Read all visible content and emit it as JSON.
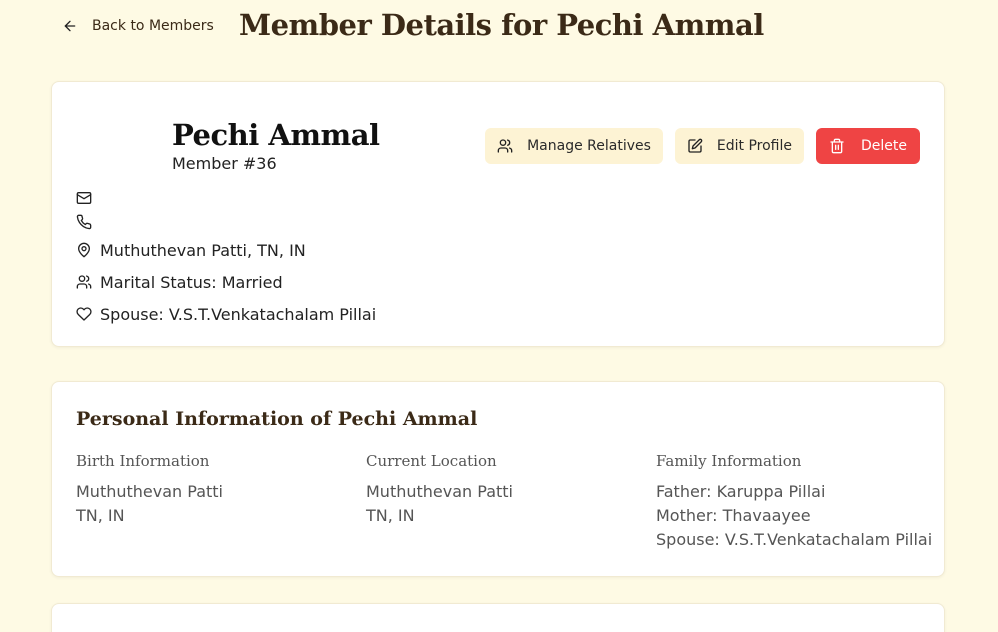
{
  "header": {
    "back_label": "Back to Members",
    "title": "Member Details for Pechi Ammal"
  },
  "profile": {
    "name": "Pechi Ammal",
    "member_number": "Member #36",
    "location": "Muthuthevan Patti, TN, IN",
    "marital_status": "Marital Status: Married",
    "spouse": "Spouse: V.S.T.Venkatachalam Pillai"
  },
  "actions": {
    "manage_relatives": "Manage Relatives",
    "edit_profile": "Edit Profile",
    "delete": "Delete"
  },
  "personal_info": {
    "title": "Personal Information of Pechi Ammal",
    "birth": {
      "heading": "Birth Information",
      "line1": "Muthuthevan Patti",
      "line2": "TN, IN"
    },
    "current": {
      "heading": "Current Location",
      "line1": "Muthuthevan Patti",
      "line2": "TN, IN"
    },
    "family": {
      "heading": "Family Information",
      "father": "Father: Karuppa Pillai",
      "mother": "Mother: Thavaayee",
      "spouse": "Spouse: V.S.T.Venkatachalam Pillai"
    }
  },
  "colors": {
    "background": "#fefae4",
    "accent": "#3b2a17",
    "danger": "#ef4444",
    "soft_button": "#fdf3d4"
  }
}
